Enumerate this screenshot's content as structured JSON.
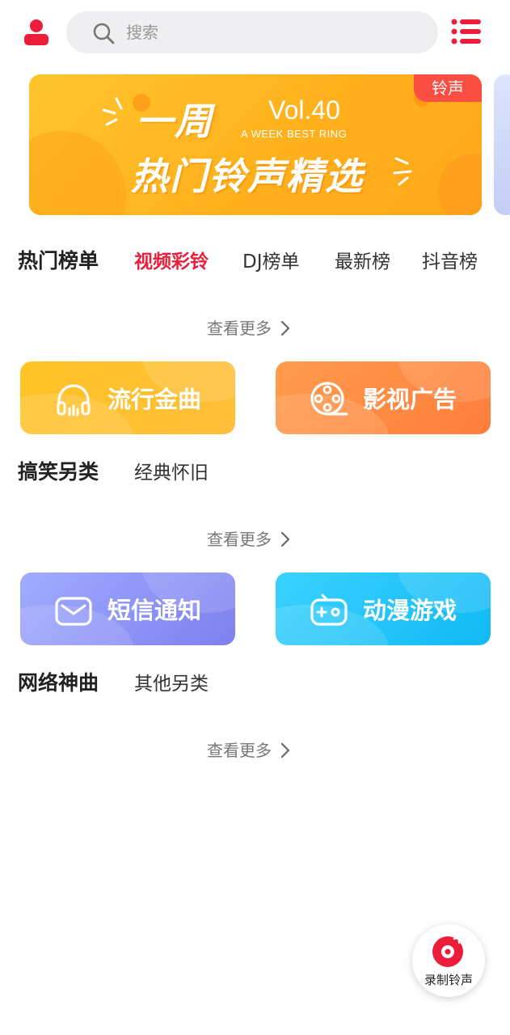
{
  "header": {
    "search_placeholder": "搜索"
  },
  "banner": {
    "title_line1": "一周",
    "vol": "Vol.40",
    "subtitle": "A WEEK BEST RING",
    "title_line2": "热门铃声精选",
    "badge": "铃声"
  },
  "sections": [
    {
      "title": "热门榜单",
      "tabs": [
        {
          "label": "视频彩铃",
          "active": true
        },
        {
          "label": "DJ榜单",
          "active": false
        },
        {
          "label": "最新榜",
          "active": false
        },
        {
          "label": "抖音榜",
          "active": false
        }
      ],
      "more": "查看更多"
    },
    {
      "title": "搞笑另类",
      "tabs": [
        {
          "label": "经典怀旧",
          "active": false
        }
      ],
      "more": "查看更多"
    },
    {
      "title": "网络神曲",
      "tabs": [
        {
          "label": "其他另类",
          "active": false
        }
      ],
      "more": "查看更多"
    }
  ],
  "categories": [
    {
      "label": "流行金曲",
      "icon": "headphones-icon",
      "color_from": "#ffc425",
      "color_to": "#ffbf3a"
    },
    {
      "label": "影视广告",
      "icon": "film-reel-icon",
      "color_from": "#ff9a4c",
      "color_to": "#ff7e3c"
    },
    {
      "label": "短信通知",
      "icon": "envelope-icon",
      "color_from": "#9aa6ff",
      "color_to": "#7f82f0"
    },
    {
      "label": "动漫游戏",
      "icon": "gamepad-icon",
      "color_from": "#3ad1ff",
      "color_to": "#12baf5"
    }
  ],
  "fab": {
    "label": "录制铃声"
  },
  "colors": {
    "accent": "#ec1d3a",
    "badge": "#fb4d42"
  }
}
